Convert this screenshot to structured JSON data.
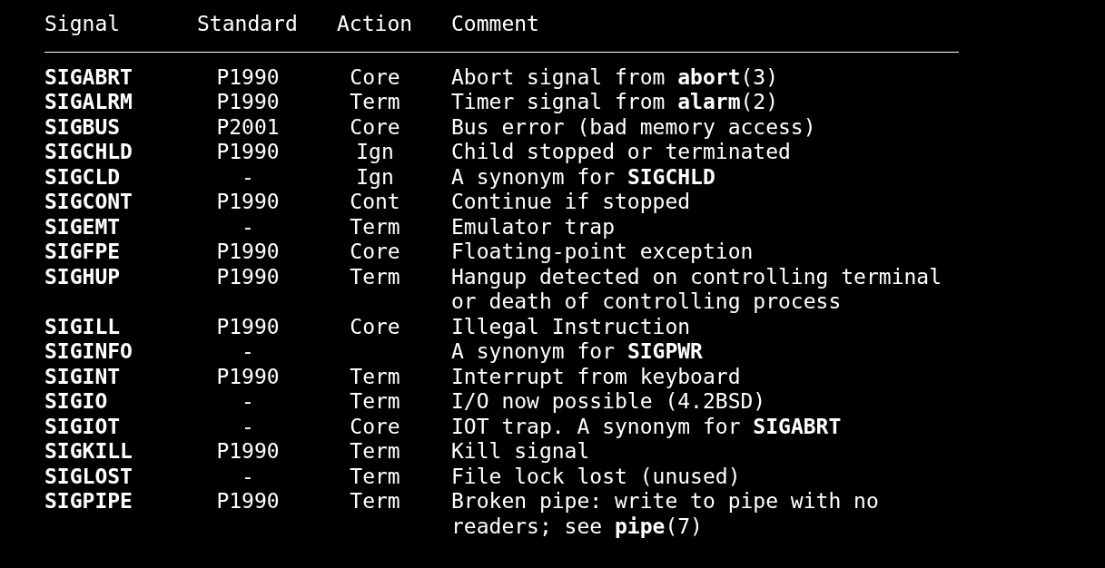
{
  "table": {
    "columns": [
      "Signal",
      "Standard",
      "Action",
      "Comment"
    ],
    "rows": [
      {
        "signal": "SIGABRT",
        "standard": "P1990",
        "action": "Core",
        "comment": [
          "Abort signal from **abort**(3)"
        ]
      },
      {
        "signal": "SIGALRM",
        "standard": "P1990",
        "action": "Term",
        "comment": [
          "Timer signal from **alarm**(2)"
        ]
      },
      {
        "signal": "SIGBUS",
        "standard": "P2001",
        "action": "Core",
        "comment": [
          "Bus error (bad memory access)"
        ]
      },
      {
        "signal": "SIGCHLD",
        "standard": "P1990",
        "action": "Ign",
        "comment": [
          "Child stopped or terminated"
        ]
      },
      {
        "signal": "SIGCLD",
        "standard": "-",
        "action": "Ign",
        "comment": [
          "A synonym for **SIGCHLD**"
        ]
      },
      {
        "signal": "SIGCONT",
        "standard": "P1990",
        "action": "Cont",
        "comment": [
          "Continue if stopped"
        ]
      },
      {
        "signal": "SIGEMT",
        "standard": "-",
        "action": "Term",
        "comment": [
          "Emulator trap"
        ]
      },
      {
        "signal": "SIGFPE",
        "standard": "P1990",
        "action": "Core",
        "comment": [
          "Floating-point exception"
        ]
      },
      {
        "signal": "SIGHUP",
        "standard": "P1990",
        "action": "Term",
        "comment": [
          "Hangup detected on controlling terminal",
          "or death of controlling process"
        ]
      },
      {
        "signal": "SIGILL",
        "standard": "P1990",
        "action": "Core",
        "comment": [
          "Illegal Instruction"
        ]
      },
      {
        "signal": "SIGINFO",
        "standard": "-",
        "action": "",
        "comment": [
          "A synonym for **SIGPWR**"
        ]
      },
      {
        "signal": "SIGINT",
        "standard": "P1990",
        "action": "Term",
        "comment": [
          "Interrupt from keyboard"
        ]
      },
      {
        "signal": "SIGIO",
        "standard": "-",
        "action": "Term",
        "comment": [
          "I/O now possible (4.2BSD)"
        ]
      },
      {
        "signal": "SIGIOT",
        "standard": "-",
        "action": "Core",
        "comment": [
          "IOT trap. A synonym for **SIGABRT**"
        ]
      },
      {
        "signal": "SIGKILL",
        "standard": "P1990",
        "action": "Term",
        "comment": [
          "Kill signal"
        ]
      },
      {
        "signal": "SIGLOST",
        "standard": "-",
        "action": "Term",
        "comment": [
          "File lock lost (unused)"
        ]
      },
      {
        "signal": "SIGPIPE",
        "standard": "P1990",
        "action": "Term",
        "comment": [
          "Broken pipe: write to pipe with no",
          "readers; see **pipe**(7)"
        ]
      }
    ]
  }
}
